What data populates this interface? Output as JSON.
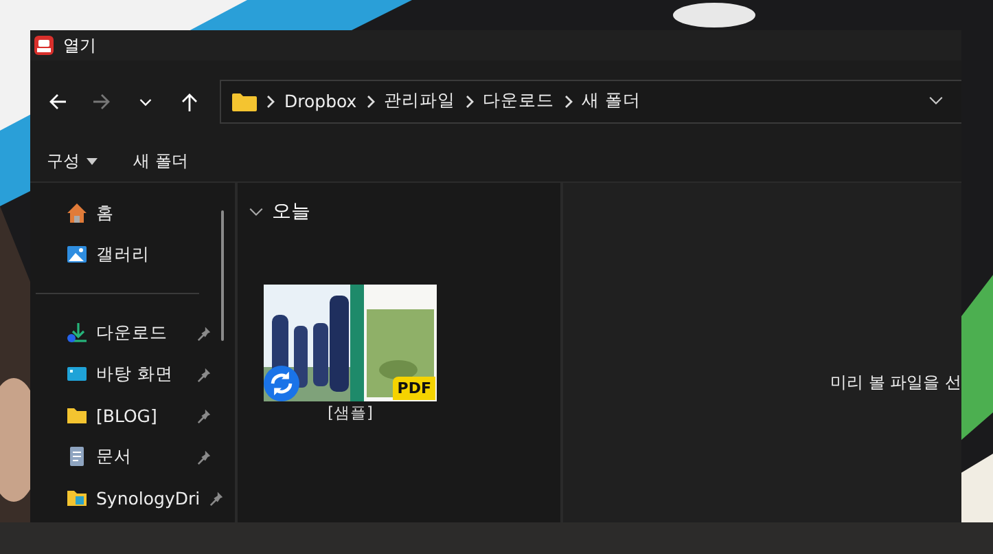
{
  "window": {
    "title": "열기"
  },
  "nav": [
    {
      "kind": "back",
      "disabled": false
    },
    {
      "kind": "forward",
      "disabled": true
    },
    {
      "kind": "recent",
      "disabled": false
    },
    {
      "kind": "up",
      "disabled": false
    }
  ],
  "address": {
    "segments": [
      "Dropbox",
      "관리파일",
      "다운로드",
      "새 폴더"
    ]
  },
  "commands": [
    {
      "label": "구성",
      "dropdown": true
    },
    {
      "label": "새 폴더",
      "dropdown": false
    }
  ],
  "sidebar": {
    "sections": [
      {
        "items": [
          {
            "label": "홈",
            "kind": "home",
            "pinned": false
          },
          {
            "label": "갤러리",
            "kind": "gallery",
            "pinned": false
          }
        ]
      },
      {
        "items": [
          {
            "label": "다운로드",
            "kind": "download",
            "pinned": true
          },
          {
            "label": "바탕 화면",
            "kind": "desktop",
            "pinned": true
          },
          {
            "label": "[BLOG]",
            "kind": "folder",
            "pinned": true
          },
          {
            "label": "문서",
            "kind": "document",
            "pinned": true
          },
          {
            "label": "SynologyDri",
            "kind": "synology",
            "pinned": true
          }
        ]
      }
    ]
  },
  "files": {
    "group": {
      "label": "오늘",
      "expanded": true
    },
    "items": [
      {
        "name": "[샘플]",
        "sync": true,
        "badge": "PDF"
      }
    ]
  },
  "preview": {
    "message": "미리 볼 파일을 선"
  }
}
